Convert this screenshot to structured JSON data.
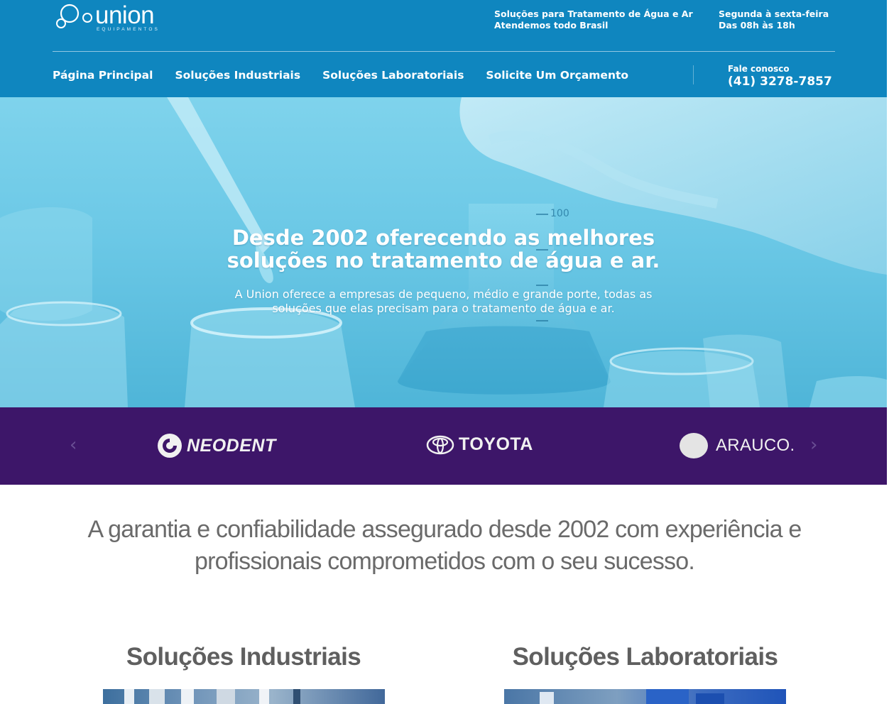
{
  "brand": {
    "logo_word": "union",
    "logo_sub": "EQUIPAMENTOS"
  },
  "top_info": {
    "services_line1": "Soluções para Tratamento de Água e Ar",
    "services_line2": "Atendemos todo Brasil",
    "hours_line1": "Segunda à sexta-feira",
    "hours_line2": "Das 08h às 18h"
  },
  "nav": {
    "items": [
      {
        "label": "Página Principal"
      },
      {
        "label": "Soluções Industriais"
      },
      {
        "label": "Soluções Laboratoriais"
      },
      {
        "label": "Solicite Um Orçamento"
      }
    ]
  },
  "contact": {
    "label": "Fale conosco",
    "phone": "(41) 3278-7857"
  },
  "hero": {
    "title_line1": "Desde 2002 oferecendo as melhores",
    "title_line2": "soluções no tratamento de água e ar.",
    "sub_line1": "A Union oferece a empresas de pequeno, médio e grande porte, todas as",
    "sub_line2": "soluções que elas precisam para o tratamento de água e ar."
  },
  "clients": {
    "prev_arrow": "‹",
    "next_arrow": "›",
    "logos": [
      {
        "name": "NEODENT",
        "icon": "neodent-logo-icon"
      },
      {
        "name": "TOYOTA",
        "icon": "toyota-logo-icon"
      },
      {
        "name": "ARAUCO.",
        "icon": "arauco-logo-icon"
      }
    ]
  },
  "tagline": {
    "line1": "A garantia e confiabilidade assegurado desde 2002 com experiência e",
    "line2": "profissionais comprometidos com o seu sucesso."
  },
  "solutions": {
    "industrial_title": "Soluções Industriais",
    "laboratory_title": "Soluções Laboratoriais"
  },
  "colors": {
    "header_bg": "#0f86bf",
    "clients_bg": "#3d1669",
    "hero_tint": "#6bc8e6",
    "text_gray": "#6a6a6a"
  }
}
